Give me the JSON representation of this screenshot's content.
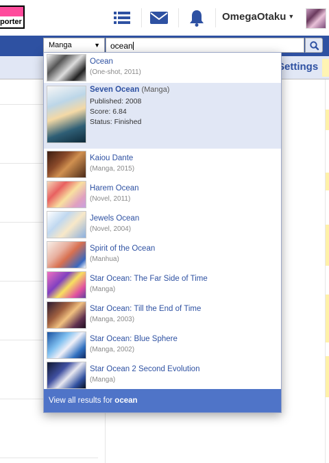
{
  "header": {
    "logo_text": "porter",
    "username": "OmegaOtaku",
    "icons": [
      "list-icon",
      "mail-icon",
      "bell-icon"
    ],
    "colors": {
      "brand": "#2e51a2",
      "logo_pink": "#ff4b9c"
    }
  },
  "search": {
    "category": "Manga",
    "query": "ocean"
  },
  "nav": {
    "settings_label": "Settings"
  },
  "dropdown": {
    "items": [
      {
        "title": "Ocean",
        "meta": "(One-shot, 2011)"
      },
      {
        "title": "Seven Ocean",
        "type": "(Manga)",
        "published": "Published: 2008",
        "score": "Score: 6.84",
        "status": "Status: Finished"
      },
      {
        "title": "Kaiou Dante",
        "meta": "(Manga, 2015)"
      },
      {
        "title": "Harem Ocean",
        "meta": "(Novel, 2011)"
      },
      {
        "title": "Jewels Ocean",
        "meta": "(Novel, 2004)"
      },
      {
        "title": "Spirit of the Ocean",
        "meta": "(Manhua)"
      },
      {
        "title": "Star Ocean: The Far Side of Time",
        "meta": "(Manga)"
      },
      {
        "title": "Star Ocean: Till the End of Time",
        "meta": "(Manga, 2003)"
      },
      {
        "title": "Star Ocean: Blue Sphere",
        "meta": "(Manga, 2002)"
      },
      {
        "title": "Star Ocean 2 Second Evolution",
        "meta": "(Manga)"
      }
    ],
    "view_all_prefix": "View all results for ",
    "view_all_query": "ocean"
  }
}
